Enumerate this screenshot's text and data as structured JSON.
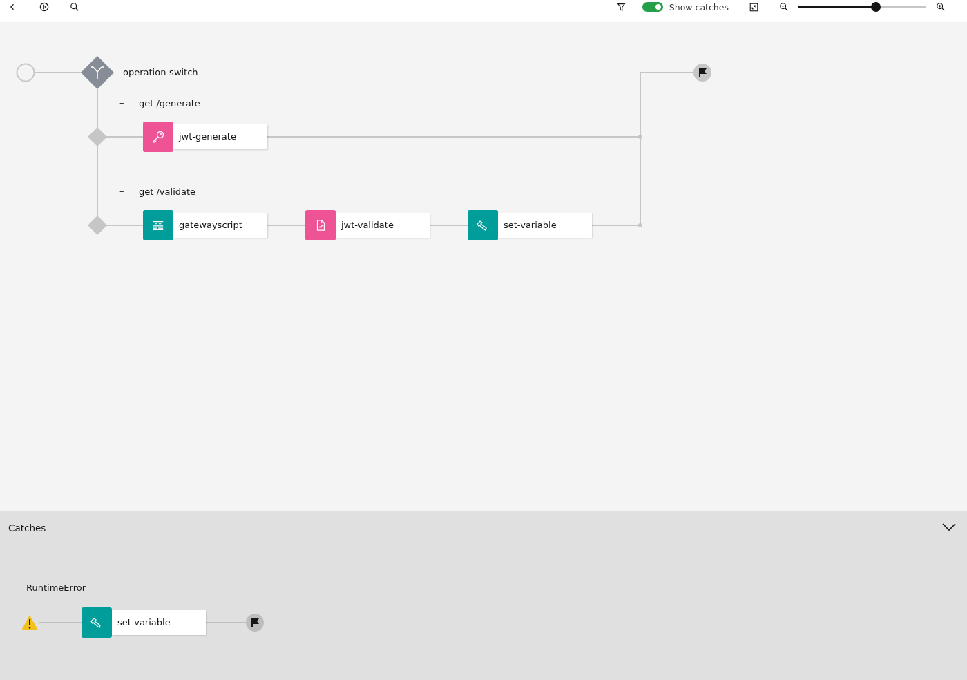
{
  "toolbar": {
    "show_catches": {
      "label": "Show catches",
      "on": true
    },
    "zoom": {
      "level": 0.61
    }
  },
  "flow": {
    "switch": {
      "label": "operation-switch"
    },
    "cases": [
      {
        "toggle": "–",
        "label": "get /generate",
        "nodes": [
          {
            "label": "jwt-generate",
            "kind": "key",
            "color": "#ee5396"
          }
        ]
      },
      {
        "toggle": "–",
        "label": "get /validate",
        "nodes": [
          {
            "label": "gatewayscript",
            "kind": "script",
            "color": "#009d9a"
          },
          {
            "label": "jwt-validate",
            "kind": "document",
            "color": "#ee5396"
          },
          {
            "label": "set-variable",
            "kind": "tool",
            "color": "#009d9a"
          }
        ]
      }
    ]
  },
  "catches": {
    "title": "Catches",
    "expanded": true,
    "items": [
      {
        "label": "RuntimeError",
        "nodes": [
          {
            "label": "set-variable",
            "kind": "tool",
            "color": "#009d9a"
          }
        ]
      }
    ]
  }
}
